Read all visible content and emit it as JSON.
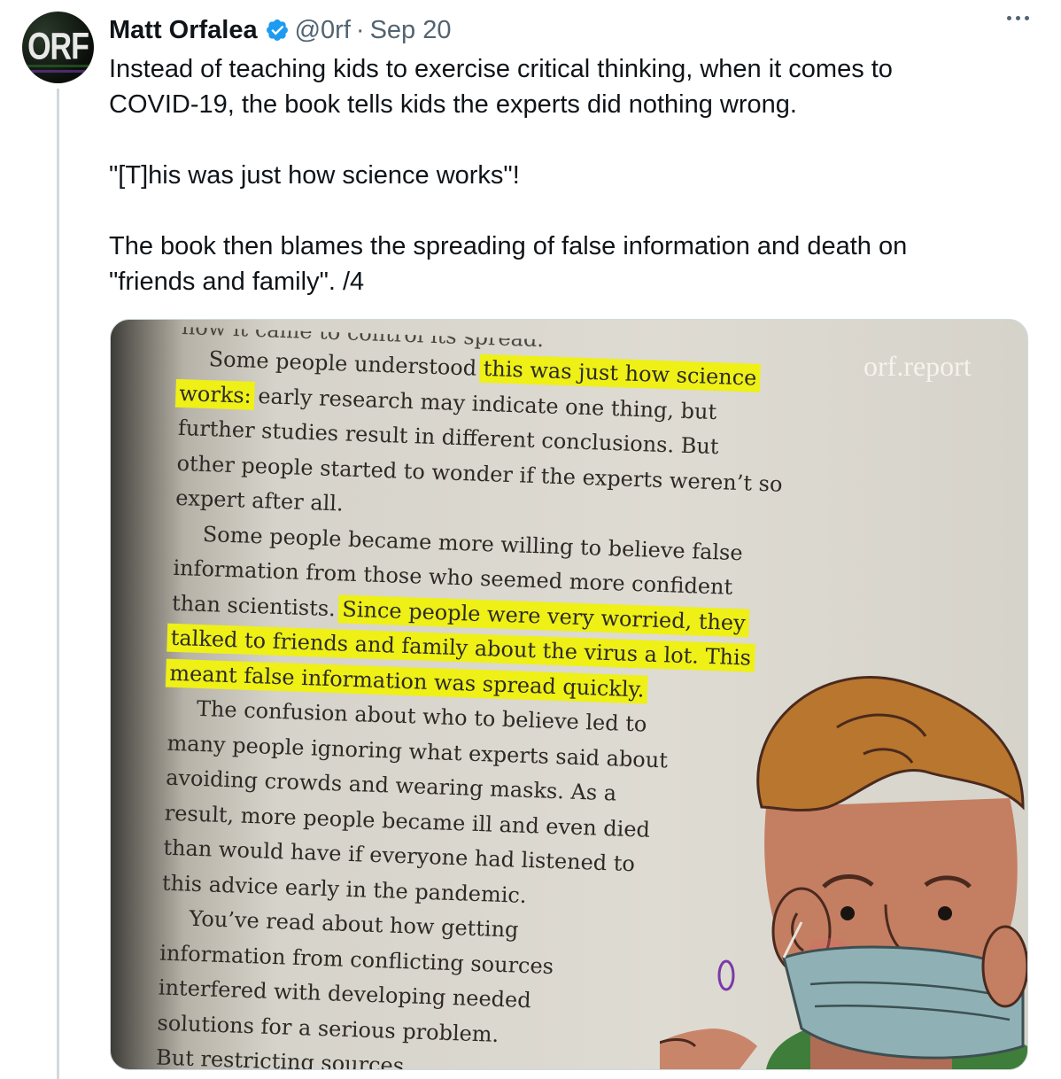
{
  "tweet": {
    "author_name": "Matt Orfalea",
    "handle": "@0rf",
    "separator": "·",
    "date": "Sep 20",
    "avatar_text": "ORF",
    "text_paragraphs": [
      [
        "Instead of teaching kids to exercise critical thinking, when it comes to",
        "COVID-19, the book tells kids the experts did nothing wrong."
      ],
      [
        "\"[T]his was just how science works\"!"
      ],
      [
        "The book then blames the spreading of false information and death on",
        "\"friends and family\". /4"
      ]
    ]
  },
  "image": {
    "watermark": "orf.report",
    "book_lines": [
      {
        "text": "how it came to control its spread.",
        "cut": true
      },
      {
        "indent": 1,
        "parts": [
          "Some people understood ",
          {
            "hl": "this was just how science"
          }
        ]
      },
      {
        "parts": [
          {
            "hl": "works:"
          },
          " early research may indicate one thing, but"
        ]
      },
      {
        "parts": [
          "further studies result in different conclusions. But"
        ]
      },
      {
        "parts": [
          "other people started to wonder if the experts weren’t so"
        ]
      },
      {
        "parts": [
          "expert after all."
        ]
      },
      {
        "indent": 1,
        "parts": [
          "Some people became more willing to believe false"
        ]
      },
      {
        "parts": [
          "information from those who seemed more confident"
        ]
      },
      {
        "parts": [
          "than scientists. ",
          {
            "hl": "Since people were very worried, they"
          }
        ]
      },
      {
        "parts": [
          {
            "hl": "talked to friends and family about the virus a lot. This"
          }
        ]
      },
      {
        "parts": [
          {
            "hl": "meant false information was spread quickly."
          }
        ]
      },
      {
        "indent": 1,
        "parts": [
          "The confusion about who to believe led to"
        ]
      },
      {
        "parts": [
          "many people ignoring what experts said about"
        ]
      },
      {
        "parts": [
          "avoiding crowds and wearing masks. As a"
        ]
      },
      {
        "parts": [
          "result, more people became ill and even died"
        ]
      },
      {
        "parts": [
          "than would have if everyone had listened to"
        ]
      },
      {
        "parts": [
          "this advice early in the pandemic."
        ]
      },
      {
        "indent": 1,
        "parts": [
          "You’ve read about how getting"
        ]
      },
      {
        "parts": [
          "information from conflicting sources"
        ]
      },
      {
        "parts": [
          "interfered with developing needed"
        ]
      },
      {
        "parts": [
          "solutions for a serious problem."
        ]
      },
      {
        "parts": [
          "But restricting sources"
        ]
      }
    ]
  },
  "icons": {
    "verified": "verified-badge-icon",
    "more": "more-options-icon"
  },
  "colors": {
    "verified": "#1d9bf0",
    "handle": "#536471",
    "highlight": "#eef016",
    "thread_line": "#cfd9de"
  }
}
